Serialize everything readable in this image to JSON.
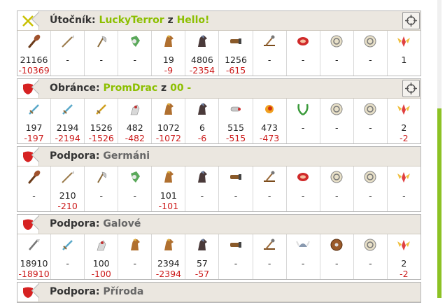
{
  "colors": {
    "accent": "#8cbf00",
    "loss": "#cc1a1a",
    "shield": "#d62222"
  },
  "panels": [
    {
      "type": "attacker",
      "label": "Útočník:",
      "player": "LuckyTerror",
      "joiner": "z",
      "tribe": "Hello!",
      "has_target": true,
      "badge_icon": "crossed-swords-icon",
      "icons": [
        "club-icon",
        "spear-icon",
        "axe-icon",
        "scout-icon",
        "light-cavalry-icon",
        "heavy-cavalry-icon",
        "ram-icon",
        "catapult-icon",
        "horn-icon",
        "shield-disc-icon",
        "ring-icon",
        "winged-helmet-icon"
      ],
      "counts": [
        "21166",
        "-",
        "-",
        "-",
        "19",
        "4806",
        "1256",
        "-",
        "-",
        "-",
        "-",
        "1"
      ],
      "losses": [
        "-10369",
        "",
        "",
        "",
        "-9",
        "-2354",
        "-615",
        "",
        "",
        "",
        "",
        ""
      ]
    },
    {
      "type": "defender",
      "label": "Obránce:",
      "player": "PromDrac",
      "joiner": "z",
      "tribe": "00 -",
      "has_target": true,
      "badge_icon": "shield-icon",
      "icons": [
        "sword-icon",
        "long-sword-icon",
        "golden-sword-icon",
        "horse-rider-icon",
        "knight-icon",
        "black-horse-icon",
        "cannon-icon",
        "fire-catapult-icon",
        "laurel-icon",
        "ring-icon",
        "ring-icon",
        "winged-helmet-icon"
      ],
      "counts": [
        "197",
        "2194",
        "1526",
        "482",
        "1072",
        "6",
        "515",
        "473",
        "-",
        "-",
        "-",
        "2"
      ],
      "losses": [
        "-197",
        "-2194",
        "-1526",
        "-482",
        "-1072",
        "-6",
        "-515",
        "-473",
        "",
        "",
        "",
        "-2"
      ]
    },
    {
      "type": "support",
      "label": "Podpora:",
      "player": "",
      "joiner": "",
      "tribe": "Germáni",
      "has_target": false,
      "badge_icon": "shield-icon",
      "icons": [
        "club-icon",
        "spear-icon",
        "axe-icon",
        "scout-icon",
        "light-cavalry-icon",
        "heavy-cavalry-icon",
        "ram-icon",
        "catapult-icon",
        "horn-icon",
        "shield-disc-icon",
        "ring-icon",
        "winged-helmet-icon"
      ],
      "counts": [
        "-",
        "210",
        "-",
        "-",
        "101",
        "-",
        "-",
        "-",
        "-",
        "-",
        "-",
        "-"
      ],
      "losses": [
        "",
        "-210",
        "",
        "",
        "-101",
        "",
        "",
        "",
        "",
        "",
        "",
        ""
      ]
    },
    {
      "type": "support",
      "label": "Podpora:",
      "player": "",
      "joiner": "",
      "tribe": "Galové",
      "has_target": false,
      "badge_icon": "shield-icon",
      "icons": [
        "phalanx-icon",
        "swordsman-icon",
        "pathfinder-icon",
        "thunder-horse-icon",
        "druid-rider-icon",
        "haeduan-icon",
        "ram-icon",
        "trebuchet-icon",
        "viking-helmet-icon",
        "round-shield-icon",
        "ring-icon",
        "winged-helmet-icon"
      ],
      "counts": [
        "18910",
        "-",
        "100",
        "-",
        "2394",
        "57",
        "-",
        "-",
        "-",
        "-",
        "-",
        "2"
      ],
      "losses": [
        "-18910",
        "",
        "-100",
        "",
        "-2394",
        "-57",
        "",
        "",
        "",
        "",
        "",
        "-2"
      ]
    },
    {
      "type": "support",
      "label": "Podpora:",
      "player": "",
      "joiner": "",
      "tribe": "Příroda",
      "has_target": false,
      "badge_icon": "shield-icon",
      "icons": [],
      "counts": [],
      "losses": []
    }
  ]
}
